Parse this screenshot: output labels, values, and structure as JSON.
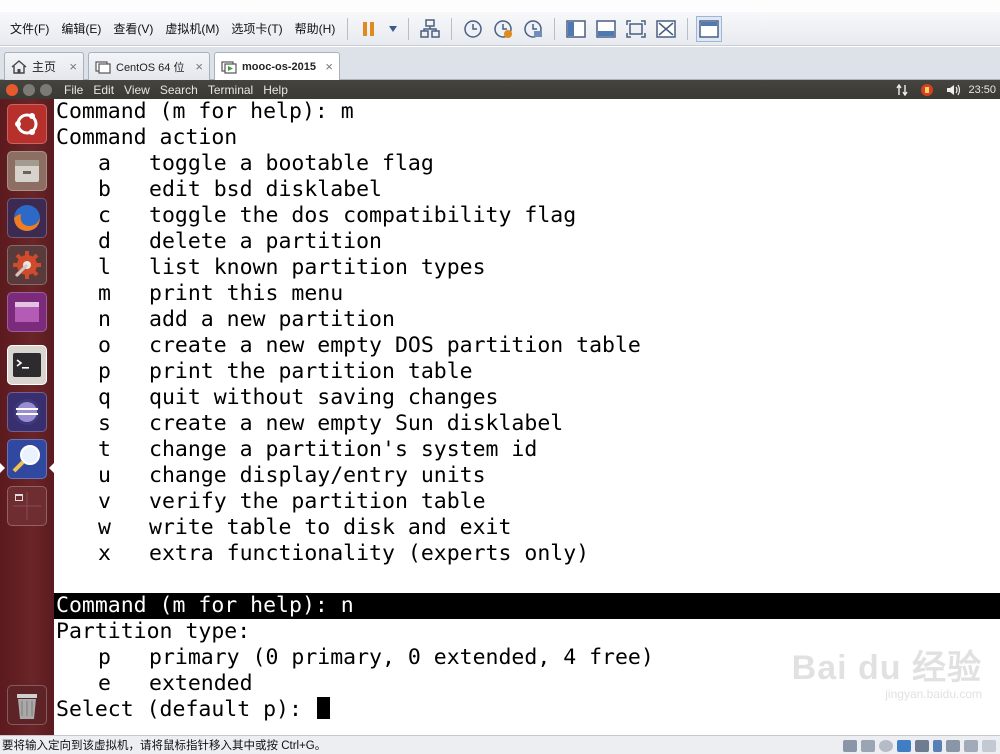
{
  "vm_menubar": {
    "menus": [
      "文件(F)",
      "编辑(E)",
      "查看(V)",
      "虚拟机(M)",
      "选项卡(T)",
      "帮助(H)"
    ]
  },
  "tabs": [
    {
      "label": "主页",
      "icon": "home-icon",
      "active": false
    },
    {
      "label": "CentOS 64 位",
      "icon": "vm-icon",
      "active": false
    },
    {
      "label": "mooc-os-2015",
      "icon": "vm-running-icon",
      "active": true
    }
  ],
  "ubuntu_panel": {
    "menus": [
      "File",
      "Edit",
      "View",
      "Search",
      "Terminal",
      "Help"
    ],
    "clock": "23:50"
  },
  "launcher": {
    "items": [
      "ubuntu-dash-icon",
      "file-manager-icon",
      "firefox-icon",
      "system-settings-icon",
      "workspace-icon",
      "terminal-icon",
      "eclipse-icon",
      "search-tool-icon",
      "workspace-switcher-icon"
    ],
    "trash": "trash-icon"
  },
  "terminal": {
    "prompt_1": "Command (m for help): m",
    "header": "Command action",
    "commands": [
      {
        "key": "a",
        "desc": "toggle a bootable flag"
      },
      {
        "key": "b",
        "desc": "edit bsd disklabel"
      },
      {
        "key": "c",
        "desc": "toggle the dos compatibility flag"
      },
      {
        "key": "d",
        "desc": "delete a partition"
      },
      {
        "key": "l",
        "desc": "list known partition types"
      },
      {
        "key": "m",
        "desc": "print this menu"
      },
      {
        "key": "n",
        "desc": "add a new partition"
      },
      {
        "key": "o",
        "desc": "create a new empty DOS partition table"
      },
      {
        "key": "p",
        "desc": "print the partition table"
      },
      {
        "key": "q",
        "desc": "quit without saving changes"
      },
      {
        "key": "s",
        "desc": "create a new empty Sun disklabel"
      },
      {
        "key": "t",
        "desc": "change a partition's system id"
      },
      {
        "key": "u",
        "desc": "change display/entry units"
      },
      {
        "key": "v",
        "desc": "verify the partition table"
      },
      {
        "key": "w",
        "desc": "write table to disk and exit"
      },
      {
        "key": "x",
        "desc": "extra functionality (experts only)"
      }
    ],
    "prompt_2": "Command (m for help): n",
    "partition_header": "Partition type:",
    "partition_types": [
      {
        "key": "p",
        "desc": "primary (0 primary, 0 extended, 4 free)"
      },
      {
        "key": "e",
        "desc": "extended"
      }
    ],
    "select_prompt": "Select (default p): "
  },
  "watermark": {
    "brand": "Bai du 经验",
    "url": "jingyan.baidu.com"
  },
  "statusbar": {
    "text": "要将输入定向到该虚拟机，请将鼠标指针移入其中或按 Ctrl+G。"
  }
}
